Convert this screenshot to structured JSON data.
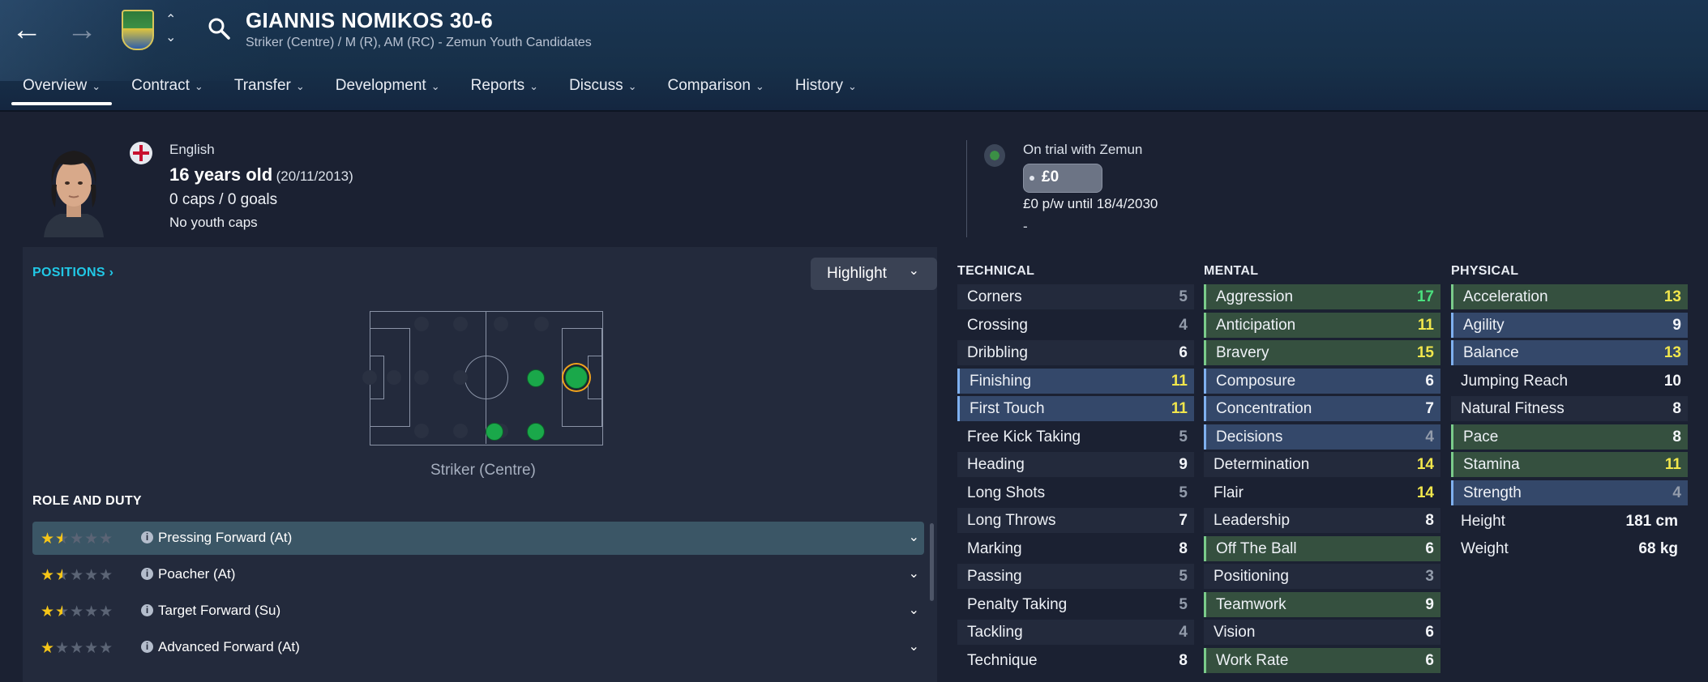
{
  "header": {
    "player_name": "GIANNIS NOMIKOS 30-6",
    "subtitle": "Striker (Centre) / M (R), AM (RC) - Zemun Youth Candidates",
    "tabs": [
      {
        "label": "Overview"
      },
      {
        "label": "Contract"
      },
      {
        "label": "Transfer"
      },
      {
        "label": "Development"
      },
      {
        "label": "Reports"
      },
      {
        "label": "Discuss"
      },
      {
        "label": "Comparison"
      },
      {
        "label": "History"
      }
    ]
  },
  "profile": {
    "nationality": "English",
    "age": "16 years old",
    "dob": "(20/11/2013)",
    "caps": "0 caps / 0 goals",
    "youth_caps": "No youth caps"
  },
  "contract": {
    "status": "On trial with Zemun",
    "value": "£0",
    "wage": "£0 p/w until 18/4/2030",
    "extra": "-"
  },
  "positions": {
    "title": "POSITIONS",
    "highlight_label": "Highlight",
    "selected_position": "Striker (Centre)"
  },
  "roles": {
    "title": "ROLE AND DUTY",
    "items": [
      {
        "name": "Pressing Forward (At)",
        "stars": 1.5
      },
      {
        "name": "Poacher (At)",
        "stars": 1.5
      },
      {
        "name": "Target Forward (Su)",
        "stars": 1.5
      },
      {
        "name": "Advanced Forward (At)",
        "stars": 1
      }
    ]
  },
  "attributes": {
    "technical": {
      "title": "TECHNICAL",
      "items": [
        {
          "name": "Corners",
          "value": "5"
        },
        {
          "name": "Crossing",
          "value": "4"
        },
        {
          "name": "Dribbling",
          "value": "6"
        },
        {
          "name": "Finishing",
          "value": "11"
        },
        {
          "name": "First Touch",
          "value": "11"
        },
        {
          "name": "Free Kick Taking",
          "value": "5"
        },
        {
          "name": "Heading",
          "value": "9"
        },
        {
          "name": "Long Shots",
          "value": "5"
        },
        {
          "name": "Long Throws",
          "value": "7"
        },
        {
          "name": "Marking",
          "value": "8"
        },
        {
          "name": "Passing",
          "value": "5"
        },
        {
          "name": "Penalty Taking",
          "value": "5"
        },
        {
          "name": "Tackling",
          "value": "4"
        },
        {
          "name": "Technique",
          "value": "8"
        }
      ]
    },
    "mental": {
      "title": "MENTAL",
      "items": [
        {
          "name": "Aggression",
          "value": "17"
        },
        {
          "name": "Anticipation",
          "value": "11"
        },
        {
          "name": "Bravery",
          "value": "15"
        },
        {
          "name": "Composure",
          "value": "6"
        },
        {
          "name": "Concentration",
          "value": "7"
        },
        {
          "name": "Decisions",
          "value": "4"
        },
        {
          "name": "Determination",
          "value": "14"
        },
        {
          "name": "Flair",
          "value": "14"
        },
        {
          "name": "Leadership",
          "value": "8"
        },
        {
          "name": "Off The Ball",
          "value": "6"
        },
        {
          "name": "Positioning",
          "value": "3"
        },
        {
          "name": "Teamwork",
          "value": "9"
        },
        {
          "name": "Vision",
          "value": "6"
        },
        {
          "name": "Work Rate",
          "value": "6"
        }
      ]
    },
    "physical": {
      "title": "PHYSICAL",
      "items": [
        {
          "name": "Acceleration",
          "value": "13"
        },
        {
          "name": "Agility",
          "value": "9"
        },
        {
          "name": "Balance",
          "value": "13"
        },
        {
          "name": "Jumping Reach",
          "value": "10"
        },
        {
          "name": "Natural Fitness",
          "value": "8"
        },
        {
          "name": "Pace",
          "value": "8"
        },
        {
          "name": "Stamina",
          "value": "11"
        },
        {
          "name": "Strength",
          "value": "4"
        }
      ],
      "height_label": "Height",
      "height": "181 cm",
      "weight_label": "Weight",
      "weight": "68 kg"
    }
  },
  "colors": {
    "accent_cyan": "#21c8e6",
    "star_yellow": "#f5c518",
    "value_yellow": "#f1e64c",
    "value_green": "#4be07e",
    "highlight_blue": "#34486a",
    "highlight_green": "#35503f"
  }
}
